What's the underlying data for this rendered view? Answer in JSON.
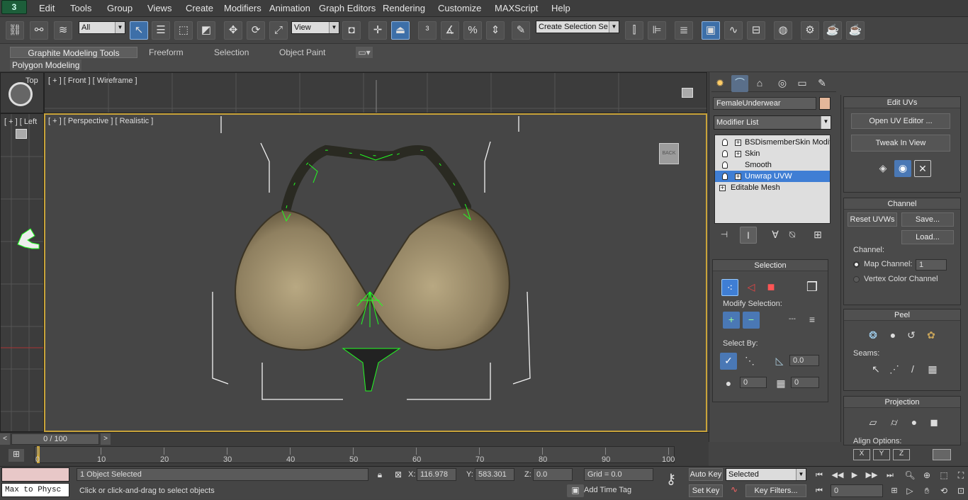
{
  "menubar": {
    "items": [
      "Edit",
      "Tools",
      "Group",
      "Views",
      "Create",
      "Modifiers",
      "Animation",
      "Graph Editors",
      "Rendering",
      "Customize",
      "MAXScript",
      "Help"
    ]
  },
  "toolbar": {
    "filter_value": "All",
    "coord_value": "View",
    "selection_set_placeholder": "Create Selection Se"
  },
  "ribbon": {
    "tabs": [
      "Graphite Modeling Tools",
      "Freeform",
      "Selection",
      "Object Paint"
    ],
    "panel_label": "Polygon Modeling"
  },
  "viewports": {
    "top_label": "Top",
    "front_label": "[ + ] [ Front ] [ Wireframe ]",
    "left_label": "[ + ] [ Left",
    "persp_label": "[ + ] [ Perspective ] [ Realistic ]",
    "viewcube_label": "BACK"
  },
  "command_panel": {
    "object_name": "FemaleUnderwear",
    "object_color": "#e4b79a",
    "modifier_list_label": "Modifier List",
    "stack": [
      {
        "label": "BSDismemberSkin Modifier",
        "selected": false
      },
      {
        "label": "Skin",
        "selected": false
      },
      {
        "label": "Smooth",
        "selected": false
      },
      {
        "label": "Unwrap UVW",
        "selected": true
      },
      {
        "label": "Editable Mesh",
        "selected": false
      }
    ],
    "selection": {
      "title": "Selection",
      "modify_selection_label": "Modify Selection:",
      "select_by_label": "Select By:",
      "angle_value": "0.0",
      "spinner1_value": "0",
      "spinner2_value": "0"
    }
  },
  "uv_panel": {
    "edit_uvs": {
      "title": "Edit UVs",
      "open_editor": "Open UV Editor ...",
      "tweak": "Tweak In View"
    },
    "channel": {
      "title": "Channel",
      "reset": "Reset UVWs",
      "save": "Save...",
      "load": "Load...",
      "channel_label": "Channel:",
      "map_channel_label": "Map Channel:",
      "map_channel_value": "1",
      "vertex_color_label": "Vertex Color Channel"
    },
    "peel": {
      "title": "Peel",
      "seams_label": "Seams:"
    },
    "projection": {
      "title": "Projection",
      "align_label": "Align Options:"
    }
  },
  "timeline": {
    "frame_display": "0 / 100",
    "ticks": [
      "0",
      "10",
      "20",
      "30",
      "40",
      "50",
      "60",
      "70",
      "80",
      "90",
      "100"
    ]
  },
  "status": {
    "selection_info": "1 Object Selected",
    "prompt": "Click or click-and-drag to select objects",
    "maxscript_listener": "Max to Physc",
    "x_label": "X:",
    "x_value": "116.978",
    "y_label": "Y:",
    "y_value": "583.301",
    "z_label": "Z:",
    "z_value": "0.0",
    "grid": "Grid = 0.0",
    "add_time_tag": "Add Time Tag",
    "auto_key": "Auto Key",
    "set_key": "Set Key",
    "selected_dropdown": "Selected",
    "key_filters": "Key Filters...",
    "current_frame": "0"
  },
  "colors": {
    "accent_blue": "#3f7ed4",
    "viewport_border": "#c8a33a",
    "wire_green": "#22ff22"
  }
}
